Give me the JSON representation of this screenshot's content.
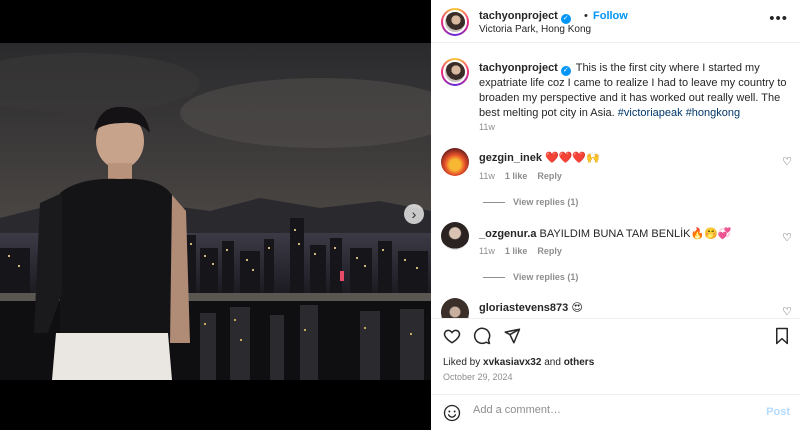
{
  "header": {
    "username": "tachyonproject",
    "separator": "•",
    "follow_label": "Follow",
    "location": "Victoria Park, Hong Kong",
    "more_icon": "more-horizontal-icon"
  },
  "caption": {
    "username": "tachyonproject",
    "text": "This is the first city where I started my expatriate life coz I came to realize I had to leave my country to broaden my perspective and it has worked out really well. The best melting pot city in Asia.",
    "hashtag1": "#victoriapeak",
    "hashtag2": "#hongkong",
    "time": "11w"
  },
  "comments": [
    {
      "username": "gezgin_inek",
      "text": "❤️❤️❤️🙌",
      "time": "11w",
      "likes": "1 like",
      "reply_label": "Reply",
      "view_replies": "View replies (1)"
    },
    {
      "username": "_ozgenur.a",
      "text": "BAYILDIM BUNA TAM BENLİK🔥🤭💞",
      "time": "11w",
      "likes": "1 like",
      "reply_label": "Reply",
      "view_replies": "View replies (1)"
    },
    {
      "username": "gloriastevens873",
      "text": "😍"
    }
  ],
  "likes": {
    "prefix": "Liked by",
    "user": "xvkasiavx32",
    "middle": "and",
    "others": "others"
  },
  "date": "October 29, 2024",
  "add_comment": {
    "placeholder": "Add a comment…",
    "post_label": "Post"
  },
  "carousel": {
    "dots": 2,
    "active": 0,
    "next_icon": "chevron-right-icon"
  },
  "colors": {
    "accent": "#0095f6",
    "hashtag": "#00376b",
    "muted": "#8e8e8e"
  }
}
